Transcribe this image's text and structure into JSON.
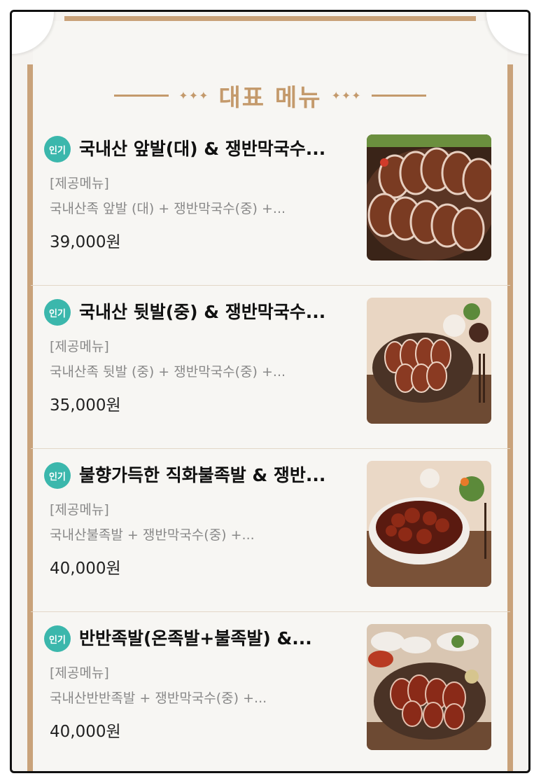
{
  "section": {
    "title": "대표 메뉴",
    "decoration_left": "✦✦✦",
    "decoration_right": "✦✦✦"
  },
  "items": [
    {
      "badge": "인기",
      "name": "국내산 앞발(대) & 쟁반막국수...",
      "sub_label": "[제공메뉴]",
      "desc": "국내산족 앞발 (대) + 쟁반막국수(중) +...",
      "price": "39,000원",
      "image": "sliced-pork-feet-photo"
    },
    {
      "badge": "인기",
      "name": "국내산 뒷발(중) & 쟁반막국수...",
      "sub_label": "[제공메뉴]",
      "desc": "국내산족 뒷발 (중) + 쟁반막국수(중) +...",
      "price": "35,000원",
      "image": "pork-feet-platter-photo"
    },
    {
      "badge": "인기",
      "name": "불향가득한 직화불족발 & 쟁반...",
      "sub_label": "[제공메뉴]",
      "desc": "국내산불족발 + 쟁반막국수(중) +...",
      "price": "40,000원",
      "image": "spicy-pork-feet-photo"
    },
    {
      "badge": "인기",
      "name": "반반족발(온족발+불족발) &...",
      "sub_label": "[제공메뉴]",
      "desc": "국내산반반족발 + 쟁반막국수(중) +...",
      "price": "40,000원",
      "image": "half-half-pork-feet-photo"
    }
  ]
}
